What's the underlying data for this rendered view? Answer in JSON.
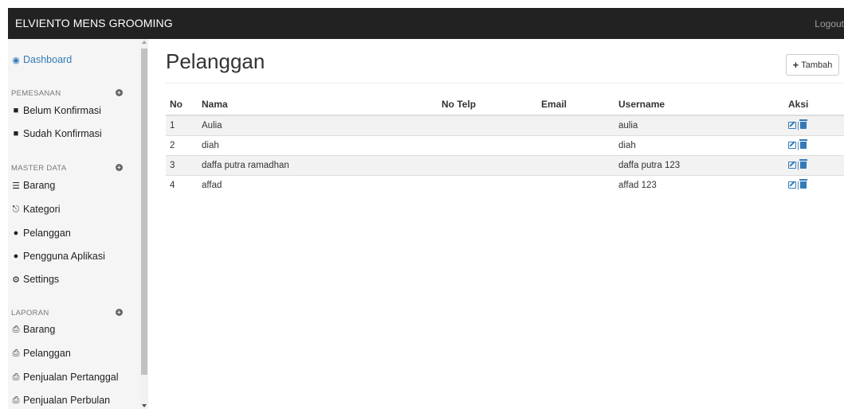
{
  "header": {
    "brand": "ELVIENTO MENS GROOMING",
    "logout_label": "Logout"
  },
  "sidebar": {
    "dashboard": "Dashboard",
    "sections": [
      {
        "title": "PEMESANAN",
        "items": [
          "Belum Konfirmasi",
          "Sudah Konfirmasi"
        ]
      },
      {
        "title": "MASTER DATA",
        "items": [
          "Barang",
          "Kategori",
          "Pelanggan",
          "Pengguna Aplikasi",
          "Settings"
        ]
      },
      {
        "title": "LAPORAN",
        "items": [
          "Barang",
          "Pelanggan",
          "Penjualan Pertanggal",
          "Penjualan Perbulan"
        ]
      }
    ]
  },
  "main": {
    "title": "Pelanggan",
    "add_button": "Tambah",
    "table": {
      "headers": [
        "No",
        "Nama",
        "No Telp",
        "Email",
        "Username",
        "Aksi"
      ],
      "rows": [
        {
          "no": "1",
          "nama": "Aulia",
          "telp": "",
          "email": "",
          "username": "aulia"
        },
        {
          "no": "2",
          "nama": "diah",
          "telp": "",
          "email": "",
          "username": "diah"
        },
        {
          "no": "3",
          "nama": "daffa putra ramadhan",
          "telp": "",
          "email": "",
          "username": "daffa putra 123"
        },
        {
          "no": "4",
          "nama": "affad",
          "telp": "",
          "email": "",
          "username": "affad 123"
        }
      ],
      "action_separator": "|"
    }
  },
  "colors": {
    "navbar": "#222222",
    "link": "#337ab7",
    "sidebar_bg": "#f5f5f5"
  }
}
